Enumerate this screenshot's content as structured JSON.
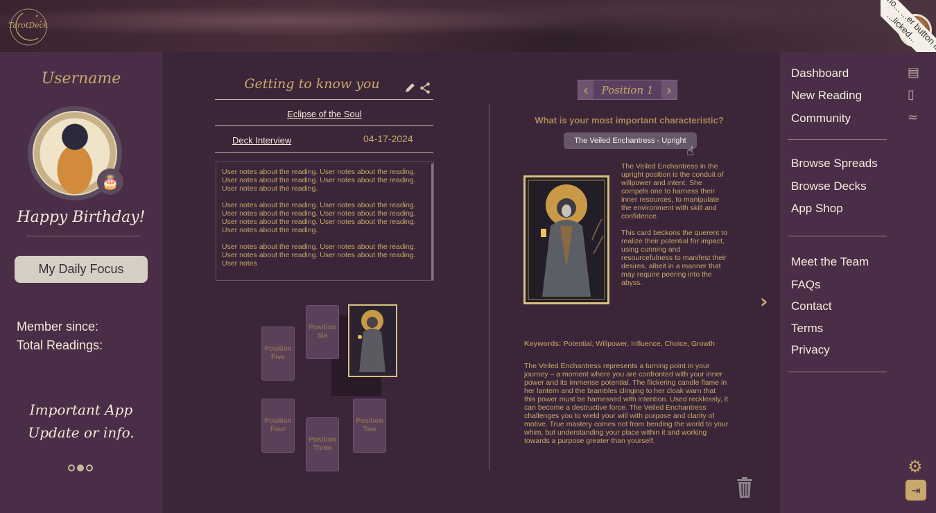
{
  "header": {
    "logo_text": "TarotDeck",
    "corner_ribbon": "...s sho... ...er button is... ...licked..."
  },
  "left_sidebar": {
    "username": "Username",
    "birthday_message": "Happy Birthday!",
    "daily_focus_label": "My Daily Focus",
    "member_since_label": "Member since:",
    "total_readings_label": "Total Readings:",
    "app_update_line1": "Important App",
    "app_update_line2": "Update or info.",
    "carousel_active_index": 1
  },
  "reading": {
    "title": "Getting to know you",
    "deck_name": "Eclipse of the Soul",
    "spread_name": "Deck Interview",
    "date": "04-17-2024",
    "notes": [
      "User notes about the reading. User notes about the reading. User notes about the reading. User notes about the reading. User notes about the reading.",
      "User notes about the reading. User notes about the reading. User notes about the reading. User notes about the reading. User notes about the reading. User notes about the reading. User notes about the reading.",
      " User notes about the reading. User notes about the reading. User notes about the reading. User notes about the reading. User notes"
    ],
    "positions": {
      "five": "Position Five",
      "six": "Position Six",
      "four": "Position Four",
      "three": "Position Three",
      "two": "Position Two"
    }
  },
  "card_detail": {
    "position_label": "Position 1",
    "question": "What is your most important characteristic?",
    "card_name": "The Veiled Enchantress - Upright",
    "description_p1": "The Veiled Enchantress in the upright position is the conduit of willpower and intent. She compels one to harness their inner resources, to manipulate the environment with skill and confidence.",
    "description_p2": "This card beckons the querent to realize their potential for impact, using cunning and resourcefulness to manifest their desires, albeit in a manner that may require peering into the abyss.",
    "keywords_label": "Keywords:",
    "keywords": "Potential, Willpower, Influence, Choice, Growth",
    "meaning": "The Veiled Enchantress represents a turning point in your journey – a moment where you are confronted with your inner power and its immense potential.  The flickering candle flame in her lantern and the brambles clinging to her cloak warn that this power must be harnessed with intention. Used recklessly, it can become a destructive force. The Veiled Enchantress challenges you to wield your will with purpose and clarity of motive. True mastery comes not from bending the world to your whim, but understanding your place within it and working towards a purpose greater than yourself."
  },
  "right_nav": {
    "dashboard": "Dashboard",
    "new_reading": "New Reading",
    "community": "Community",
    "browse_spreads": "Browse Spreads",
    "browse_decks": "Browse Decks",
    "app_shop": "App Shop",
    "meet_team": "Meet the Team",
    "faqs": "FAQs",
    "contact": "Contact",
    "terms": "Terms",
    "privacy": "Privacy"
  },
  "colors": {
    "accent_gold": "#c8a96b",
    "panel_dark": "#3b2538",
    "sidebar": "#4a2e47"
  }
}
